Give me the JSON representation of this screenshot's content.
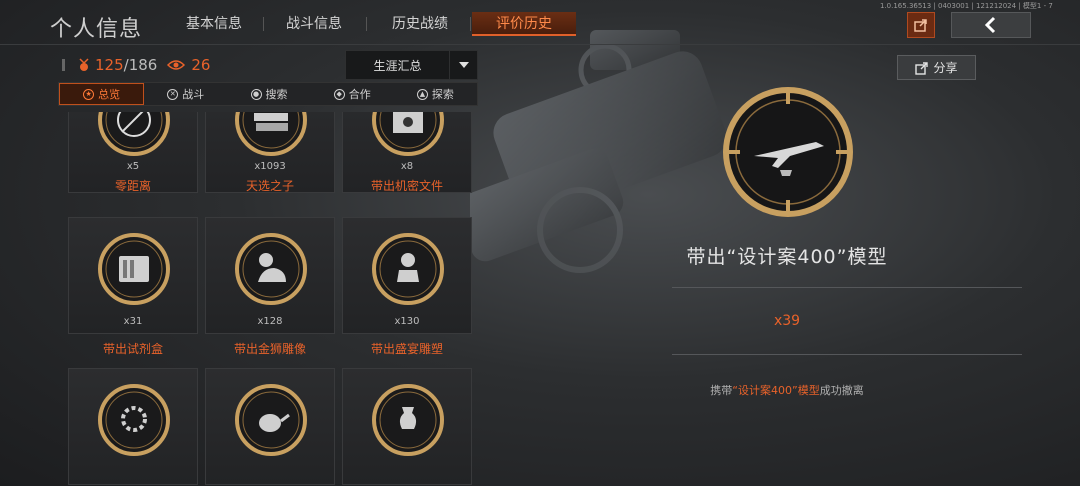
{
  "header": {
    "title": "个人信息",
    "tabs": [
      {
        "label": "基本信息",
        "active": false
      },
      {
        "label": "战斗信息",
        "active": false
      },
      {
        "label": "历史战绩",
        "active": false
      },
      {
        "label": "评价历史",
        "active": true
      }
    ],
    "version_text": "1.0.165.36513 | 0403001 | 121212024 | 模型1 - 7"
  },
  "stats": {
    "achieved": "125",
    "separator": "/",
    "total": "186",
    "views": "26"
  },
  "career_select": {
    "label": "生涯汇总"
  },
  "category_tabs": [
    {
      "label": "总览",
      "icon": "star-icon",
      "active": true
    },
    {
      "label": "战斗",
      "icon": "crosshair-icon",
      "active": false
    },
    {
      "label": "搜索",
      "icon": "search-icon",
      "active": false
    },
    {
      "label": "合作",
      "icon": "handshake-icon",
      "active": false
    },
    {
      "label": "探索",
      "icon": "compass-icon",
      "active": false
    }
  ],
  "achievements": [
    {
      "name": "零距离",
      "count": "x5",
      "icon": "no-gun-icon"
    },
    {
      "name": "天选之子",
      "count": "x1093",
      "icon": "cash-stack-icon"
    },
    {
      "name": "带出机密文件",
      "count": "x8",
      "icon": "secret-files-icon"
    },
    {
      "name": "带出试剂盒",
      "count": "x31",
      "icon": "reagent-box-icon"
    },
    {
      "name": "带出金狮雕像",
      "count": "x128",
      "icon": "lion-statue-icon"
    },
    {
      "name": "带出盛宴雕塑",
      "count": "x130",
      "icon": "feast-bust-icon"
    },
    {
      "name": "",
      "count": "",
      "icon": "gear-relic-icon"
    },
    {
      "name": "",
      "count": "",
      "icon": "teapot-icon"
    },
    {
      "name": "",
      "count": "",
      "icon": "vase-icon"
    }
  ],
  "detail": {
    "share_label": "分享",
    "title": "带出“设计案400”模型",
    "count": "x39",
    "desc_prefix": "携带",
    "desc_highlight": "“设计案400”模型",
    "desc_suffix": "成功撤离",
    "icon": "jet-model-icon"
  },
  "colors": {
    "accent": "#e8622a",
    "gold": "#c8a060",
    "panel": "#2a2b2d"
  }
}
